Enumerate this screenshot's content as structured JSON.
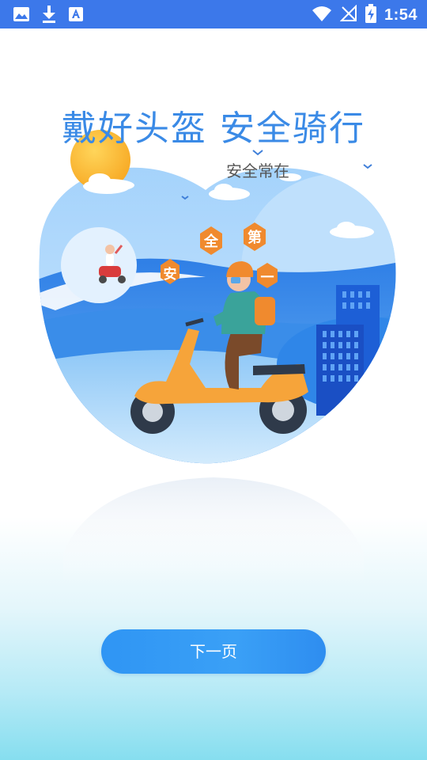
{
  "status_bar": {
    "time": "1:54",
    "left_icons": [
      "image-icon",
      "download-icon",
      "font-icon"
    ],
    "right_icons": [
      "wifi-icon",
      "no-signal-icon",
      "battery-charging-icon"
    ],
    "background_color": "#3c78ea"
  },
  "onboarding": {
    "title": "戴好头盔 安全骑行",
    "subtitle": "安全常在",
    "badges": [
      "安",
      "全",
      "第",
      "一"
    ],
    "next_button_label": "下一页"
  },
  "colors": {
    "title": "#3a8ae6",
    "button": "#2f95f4",
    "badge": "#f08a2e"
  }
}
